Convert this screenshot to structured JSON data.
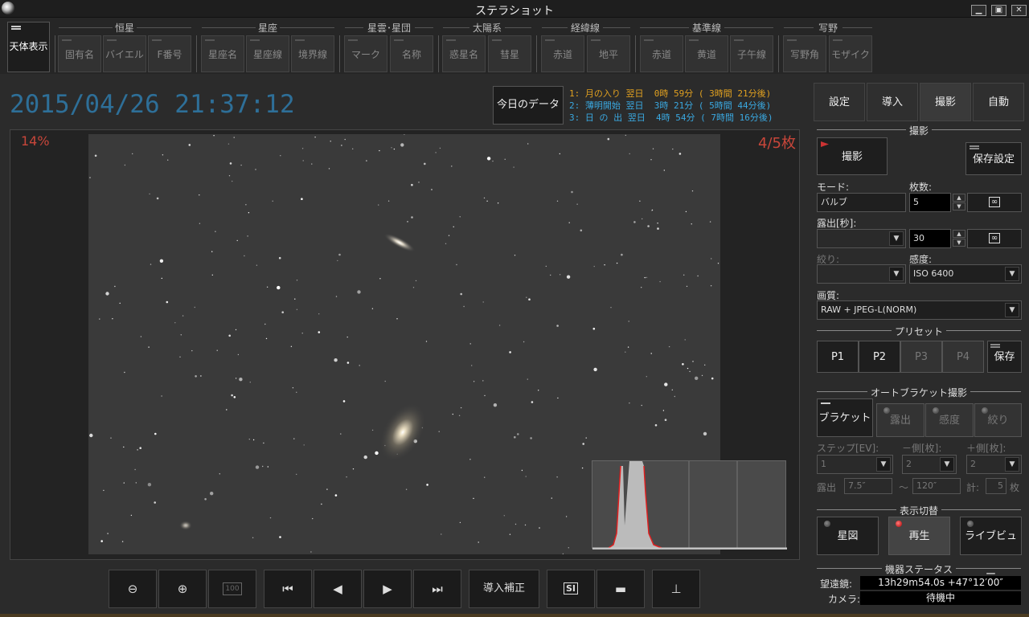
{
  "window": {
    "title": "ステラショット",
    "min": "▁",
    "restore": "▣",
    "close": "✕"
  },
  "toolbar": {
    "celestial_display": "天体表示",
    "groups": [
      {
        "label": "恒星",
        "buttons": [
          "固有名",
          "バイエル",
          "F番号"
        ]
      },
      {
        "label": "星座",
        "buttons": [
          "星座名",
          "星座線",
          "境界線"
        ]
      },
      {
        "label": "星雲･星団",
        "buttons": [
          "マーク",
          "名称"
        ]
      },
      {
        "label": "太陽系",
        "buttons": [
          "惑星名",
          "彗星"
        ]
      },
      {
        "label": "経緯線",
        "buttons": [
          "赤道",
          "地平"
        ]
      },
      {
        "label": "基準線",
        "buttons": [
          "赤道",
          "黄道",
          "子午線"
        ]
      },
      {
        "label": "写野",
        "buttons": [
          "写野角",
          "モザイク"
        ]
      }
    ]
  },
  "datetime": "2015/04/26 21:37:12",
  "today_button": "今日のデータ",
  "events": [
    {
      "text": "1: 月の入り 翌日  0時 59分 ( 3時間 21分後)",
      "color": "#e0a020"
    },
    {
      "text": "2: 薄明開始 翌日  3時 21分 ( 5時間 44分後)",
      "color": "#3aa8e0"
    },
    {
      "text": "3: 日 の 出 翌日  4時 54分 ( 7時間 16分後)",
      "color": "#3aa8e0"
    }
  ],
  "viewer": {
    "zoom": "14%",
    "frame_count": "4/5枚"
  },
  "bottom_buttons": {
    "zoom_out": "⊖",
    "zoom_in": "⊕",
    "actual": "100",
    "first": "⏮",
    "prev": "◀",
    "next": "▶",
    "last": "⏭",
    "goto_correct": "導入補正",
    "si": "SI",
    "folder": "▬",
    "levels": "⊥"
  },
  "tabs": [
    "設定",
    "導入",
    "撮影",
    "自動"
  ],
  "capture": {
    "section": "撮影",
    "shoot": "撮影",
    "save_settings": "保存設定",
    "mode_label": "モード:",
    "mode_value": "バルブ",
    "count_label": "枚数:",
    "count_value": "5",
    "exposure_label": "露出[秒]:",
    "exposure_value": "30",
    "aperture_label": "絞り:",
    "iso_label": "感度:",
    "iso_value": "ISO 6400",
    "quality_label": "画質:",
    "quality_value": "RAW + JPEG-L(NORM)",
    "inf_button": "∞"
  },
  "preset": {
    "section": "プリセット",
    "p1": "P1",
    "p2": "P2",
    "p3": "P3",
    "p4": "P4",
    "save": "保存"
  },
  "bracket": {
    "section": "オートブラケット撮影",
    "bracket": "ブラケット",
    "exposure": "露出",
    "sensitivity": "感度",
    "aperture": "絞り",
    "step_label": "ステップ[EV]:",
    "minus_label": "－側[枚]:",
    "plus_label": "＋側[枚]:",
    "step_value": "1",
    "minus_value": "2",
    "plus_value": "2",
    "exp_label": "露出",
    "exp_from": "7.5″",
    "tilde": "～",
    "exp_to": "120″",
    "total_label": "計:",
    "total_value": "5",
    "unit": "枚"
  },
  "display_switch": {
    "section": "表示切替",
    "star_chart": "星図",
    "playback": "再生",
    "live_view": "ライブビュー"
  },
  "device": {
    "section": "機器ステータス",
    "scope_label": "望遠鏡:",
    "scope_value": "13h29m54.0s +47°12′00″",
    "camera_label": "カメラ:",
    "camera_value": "待機中"
  }
}
